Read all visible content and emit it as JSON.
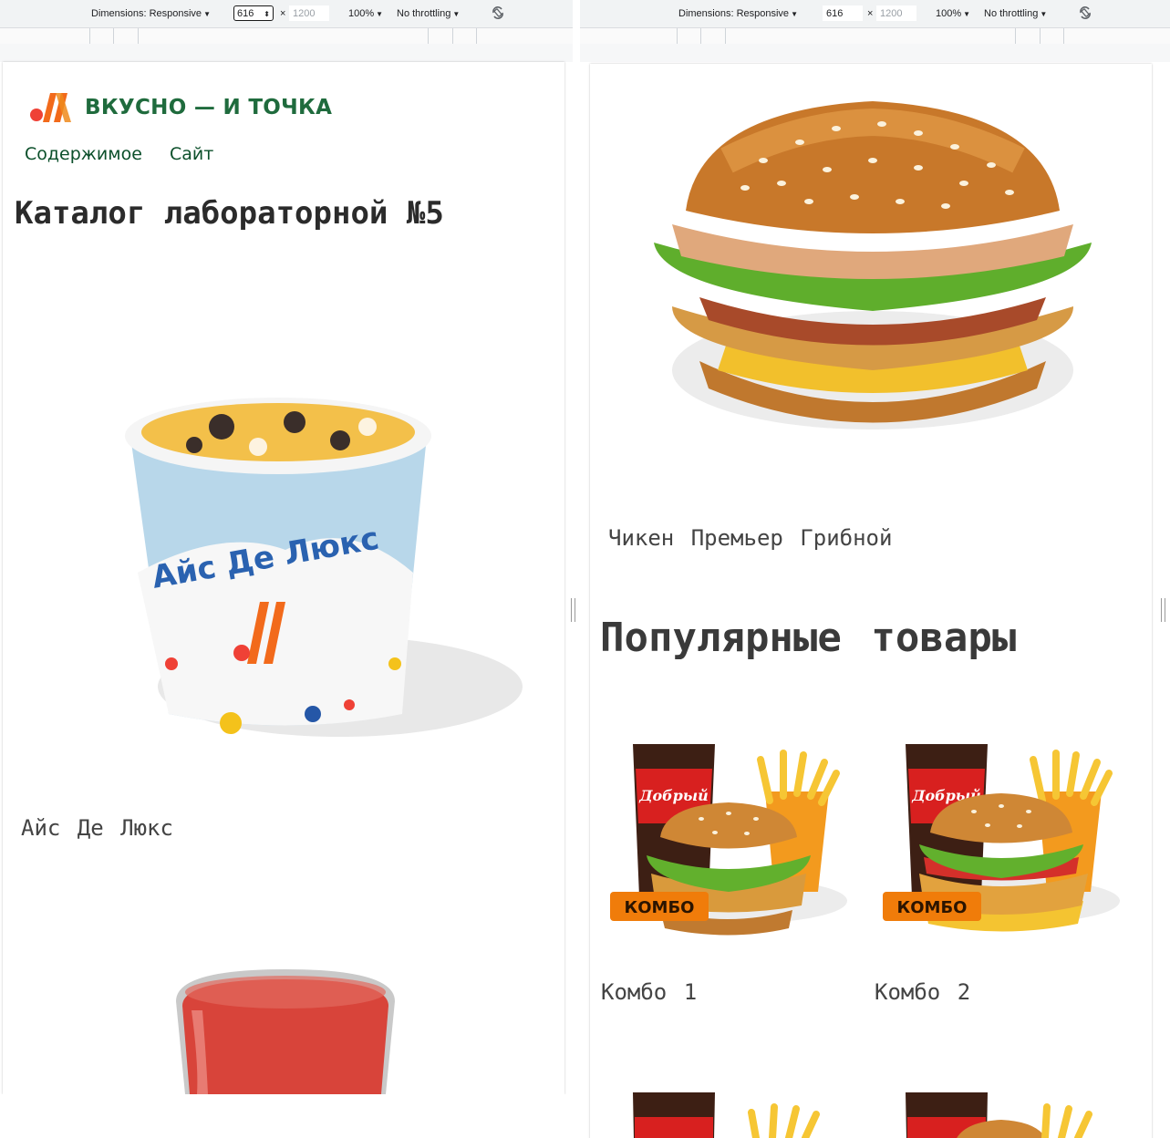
{
  "devtools": {
    "dimensions_label": "Dimensions: Responsive",
    "width": "616",
    "height_placeholder": "1200",
    "zoom": "100%",
    "throttling": "No throttling",
    "times": "×"
  },
  "site": {
    "brand": "ВКУСНО — И ТОЧКА",
    "nav": [
      "Содержимое",
      "Сайт"
    ],
    "page_title": "Каталог лабораторной №5",
    "colors": {
      "brand_green": "#1f6b3d",
      "brand_orange": "#f26a1b",
      "brand_red": "#ef4136",
      "combo_badge": "#f07c0a"
    }
  },
  "left_view": {
    "items": [
      {
        "name": "Айс Де Люкс",
        "image": "ice-cream-cup"
      },
      {
        "image": "tomato-juice-glass"
      }
    ]
  },
  "right_view": {
    "top_item": {
      "name": "Чикен Премьер Грибной",
      "image": "chicken-burger"
    },
    "popular_heading": "Популярные товары",
    "popular": [
      {
        "name": "Комбо 1",
        "badge": "КОМБО",
        "cup_text": "Добрый"
      },
      {
        "name": "Комбо 2",
        "badge": "КОМБО",
        "cup_text": "Добрый"
      }
    ]
  }
}
